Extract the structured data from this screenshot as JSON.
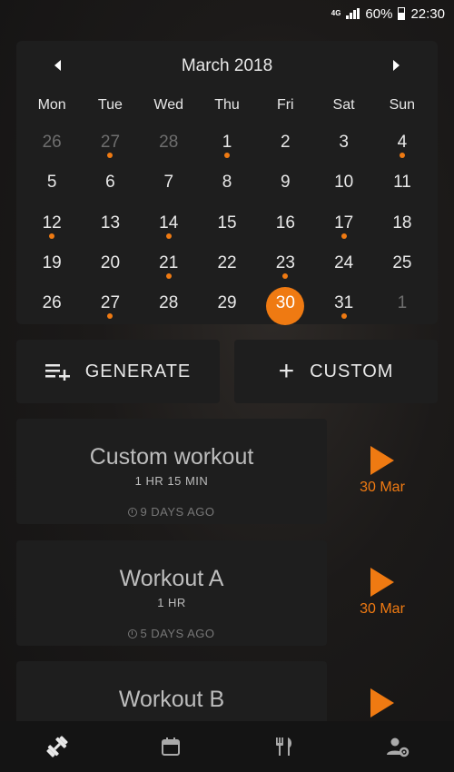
{
  "status_bar": {
    "network": "4G",
    "battery": "60%",
    "time": "22:30"
  },
  "calendar": {
    "title": "March 2018",
    "weekdays": [
      "Mon",
      "Tue",
      "Wed",
      "Thu",
      "Fri",
      "Sat",
      "Sun"
    ],
    "days": [
      {
        "n": "26",
        "muted": true,
        "dot": false
      },
      {
        "n": "27",
        "muted": true,
        "dot": true
      },
      {
        "n": "28",
        "muted": true,
        "dot": false
      },
      {
        "n": "1",
        "muted": false,
        "dot": true
      },
      {
        "n": "2",
        "muted": false,
        "dot": false
      },
      {
        "n": "3",
        "muted": false,
        "dot": false
      },
      {
        "n": "4",
        "muted": false,
        "dot": true
      },
      {
        "n": "5",
        "muted": false,
        "dot": false
      },
      {
        "n": "6",
        "muted": false,
        "dot": false
      },
      {
        "n": "7",
        "muted": false,
        "dot": false
      },
      {
        "n": "8",
        "muted": false,
        "dot": false
      },
      {
        "n": "9",
        "muted": false,
        "dot": false
      },
      {
        "n": "10",
        "muted": false,
        "dot": false
      },
      {
        "n": "11",
        "muted": false,
        "dot": false
      },
      {
        "n": "12",
        "muted": false,
        "dot": true
      },
      {
        "n": "13",
        "muted": false,
        "dot": false
      },
      {
        "n": "14",
        "muted": false,
        "dot": true
      },
      {
        "n": "15",
        "muted": false,
        "dot": false
      },
      {
        "n": "16",
        "muted": false,
        "dot": false
      },
      {
        "n": "17",
        "muted": false,
        "dot": true
      },
      {
        "n": "18",
        "muted": false,
        "dot": false
      },
      {
        "n": "19",
        "muted": false,
        "dot": false
      },
      {
        "n": "20",
        "muted": false,
        "dot": false
      },
      {
        "n": "21",
        "muted": false,
        "dot": true
      },
      {
        "n": "22",
        "muted": false,
        "dot": false
      },
      {
        "n": "23",
        "muted": false,
        "dot": true
      },
      {
        "n": "24",
        "muted": false,
        "dot": false
      },
      {
        "n": "25",
        "muted": false,
        "dot": false
      },
      {
        "n": "26",
        "muted": false,
        "dot": false
      },
      {
        "n": "27",
        "muted": false,
        "dot": true
      },
      {
        "n": "28",
        "muted": false,
        "dot": false
      },
      {
        "n": "29",
        "muted": false,
        "dot": false
      },
      {
        "n": "30",
        "muted": false,
        "dot": false,
        "selected": true
      },
      {
        "n": "31",
        "muted": false,
        "dot": true
      },
      {
        "n": "1",
        "muted": true,
        "dot": false
      }
    ]
  },
  "actions": {
    "generate_label": "GENERATE",
    "custom_label": "CUSTOM"
  },
  "workouts": [
    {
      "name": "Custom workout",
      "duration": "1 HR 15 MIN",
      "ago": "9 DAYS AGO",
      "date": "30 Mar"
    },
    {
      "name": "Workout A",
      "duration": "1 HR",
      "ago": "5 DAYS AGO",
      "date": "30 Mar"
    },
    {
      "name": "Workout B",
      "duration": "",
      "ago": "",
      "date": ""
    }
  ],
  "nav": {
    "tabs": [
      "workouts-icon",
      "calendar-icon",
      "nutrition-icon",
      "profile-settings-icon"
    ]
  },
  "colors": {
    "accent": "#ef7a12",
    "card": "#1e1e1e"
  }
}
